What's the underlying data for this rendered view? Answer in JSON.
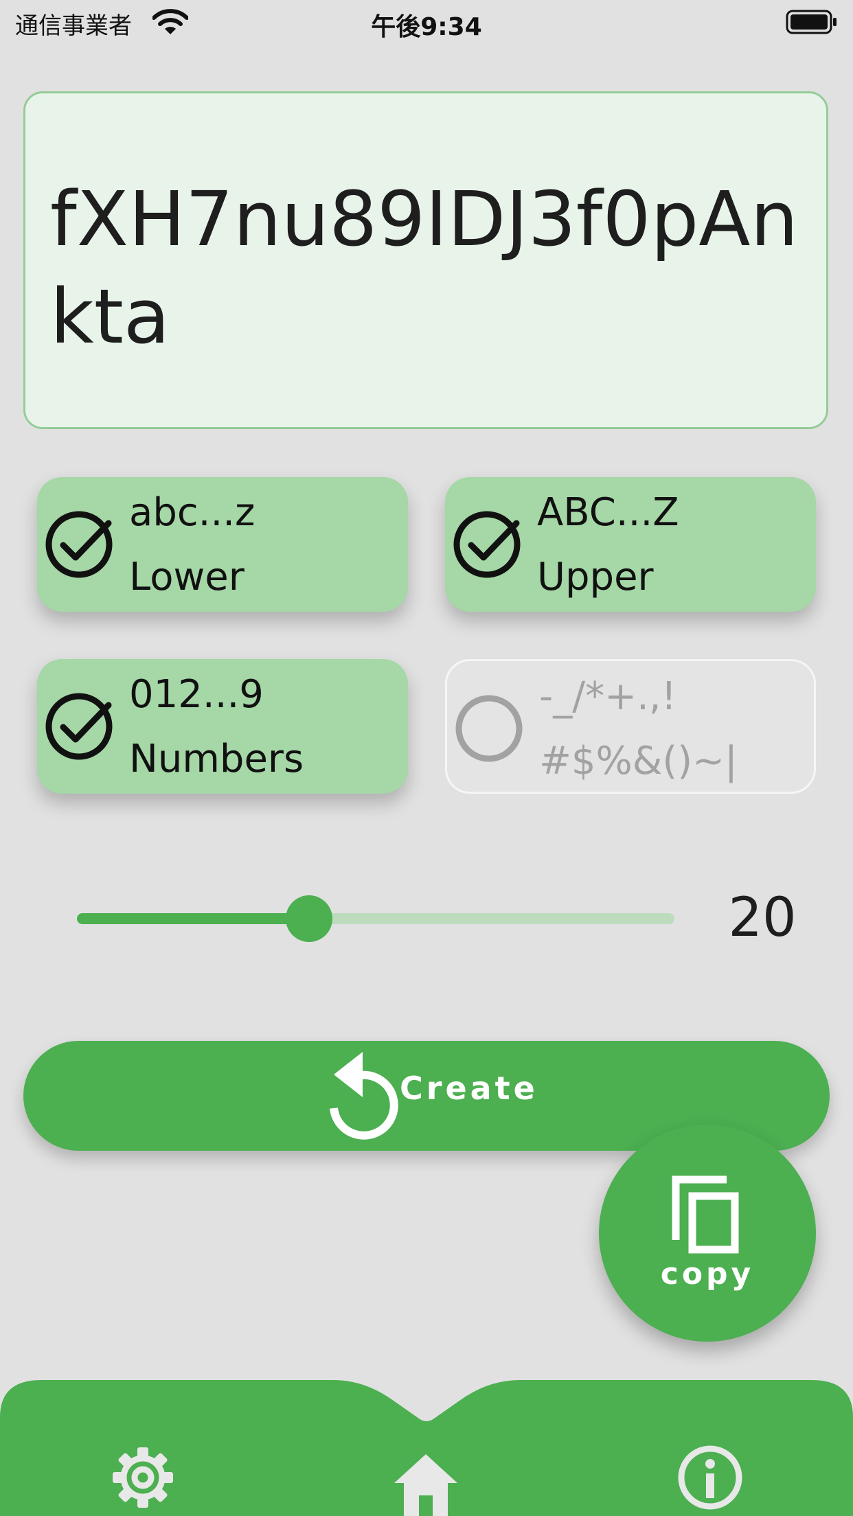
{
  "status_bar": {
    "carrier": "通信事業者",
    "time": "午後9:34"
  },
  "password": {
    "value": "fXH7nu89IDJ3f0pAnkta"
  },
  "options": [
    {
      "line1": "abc...z",
      "line2": "Lower",
      "checked": true
    },
    {
      "line1": "ABC...Z",
      "line2": "Upper",
      "checked": true
    },
    {
      "line1": "012...9",
      "line2": "Numbers",
      "checked": true
    },
    {
      "line1": "-_/*+.,!",
      "line2": "#$%&()~|",
      "checked": false
    }
  ],
  "length_slider": {
    "value": "20"
  },
  "create_button": {
    "label": "Create",
    "icon": "refresh-icon"
  },
  "copy_button": {
    "label": "copy",
    "icon": "copy-icon"
  },
  "bottom_nav": {
    "items": [
      "settings",
      "home",
      "info"
    ]
  },
  "colors": {
    "accent": "#4caf50",
    "accent_light": "#a5d7a7",
    "box_bg": "#e8f4ea",
    "background": "#e1e1e1"
  }
}
